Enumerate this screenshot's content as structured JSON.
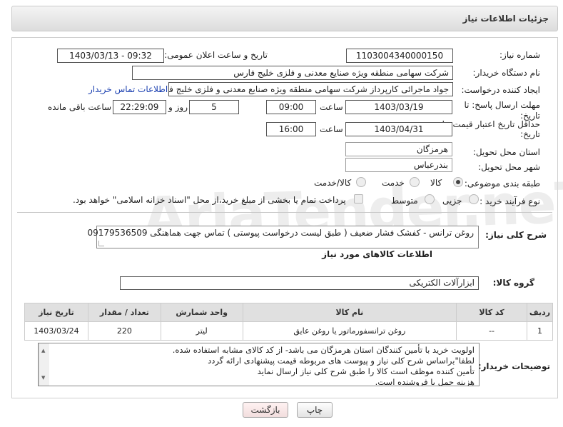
{
  "header": {
    "title": "جزئیات اطلاعات نیاز"
  },
  "form": {
    "need_number_label": "شماره نیاز:",
    "need_number": "1103004340000150",
    "announce_label": "تاریخ و ساعت اعلان عمومی:",
    "announce_value": "1403/03/13 - 09:32",
    "buyer_org_label": "نام دستگاه خریدار:",
    "buyer_org": "شرکت سهامی منطقه ویژه صنایع معدنی و فلزی خلیج فارس",
    "creator_label": "ایجاد کننده درخواست:",
    "creator": "جواد ماجرائی کارپرداز شرکت سهامی منطقه ویژه صنایع معدنی و فلزی خلیج فار",
    "contact_link": "اطلاعات تماس خریدار",
    "deadline_label_1": "مهلت ارسال پاسخ: تا",
    "deadline_label_2": "تاریخ:",
    "deadline_date": "1403/03/19",
    "time_label": "ساعت",
    "deadline_time": "09:00",
    "days_value": "5",
    "days_label": "روز و",
    "remaining_time": "22:29:09",
    "remaining_label": "ساعت باقی مانده",
    "validity_label_1": "حداقل تاریخ اعتبار قیمت: تا",
    "validity_label_2": "تاریخ:",
    "validity_date": "1403/04/31",
    "validity_time_label": "ساعت",
    "validity_time": "16:00",
    "province_label": "استان محل تحویل:",
    "province": "هرمزگان",
    "city_label": "شهر محل تحویل:",
    "city": "بندرعباس",
    "category_label": "طبقه بندی موضوعی:",
    "cat_options": [
      "کالا",
      "خدمت",
      "کالا/خدمت"
    ],
    "cat_selected": "کالا",
    "process_label": "نوع فرآیند خرید :",
    "process_options": [
      "جزیی",
      "متوسط"
    ],
    "process_note": "پرداخت تمام یا بخشی از مبلغ خرید،از محل \"اسناد خزانه اسلامی\" خواهد بود.",
    "desc_label": "شرح کلی نیاز:",
    "desc": "روغن ترانس - کفشک فشار ضعیف ( طبق لیست درخواست پیوستی ) تماس جهت هماهنگی 09179536509"
  },
  "goods": {
    "section_title": "اطلاعات کالاهای مورد نیاز",
    "group_label": "گروه کالا:",
    "group_value": "ابزارآلات الکتریکی",
    "columns": [
      "ردیف",
      "کد کالا",
      "نام کالا",
      "واحد شمارش",
      "تعداد / مقدار",
      "تاریخ نیاز"
    ],
    "rows": [
      {
        "idx": "1",
        "code": "--",
        "name": "روغن ترانسفورماتور یا روغن عایق",
        "unit": "لیتر",
        "qty": "220",
        "date": "1403/03/24"
      }
    ]
  },
  "buyer_notes": {
    "label": "توضیحات خریدار:",
    "lines": [
      "اولویت خرید با تأمین کنندگان استان هرمزگان می باشد- از کد کالای مشابه استفاده شده.",
      "لطفا\"براساس شرح کلی نیاز و پیوست های مربوطه قیمت پیشنهادی ارائه گردد",
      "تأمین کننده موظف است کالا را طبق شرح کلی نیاز ارسال نماید",
      "هزینه حمل با فروشنده است."
    ]
  },
  "buttons": {
    "print": "چاپ",
    "back": "بازگشت"
  },
  "watermark": "AriaTender.neT"
}
